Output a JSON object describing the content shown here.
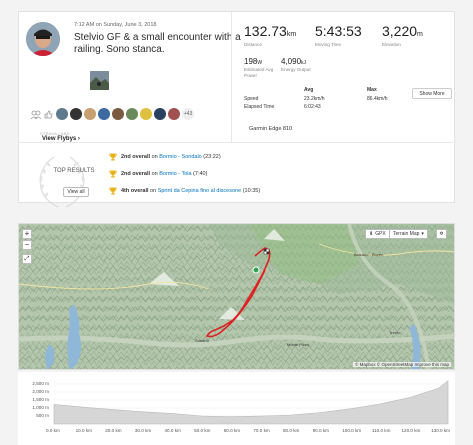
{
  "activity": {
    "date": "7:12 AM on Sunday, June 3, 2018",
    "title": "Stelvio GF & a small encounter with a railing. Sono stanca.",
    "kudos_more": "+43",
    "flyby_label": "STRAVA LABS",
    "flyby_link": "View Flybys ›"
  },
  "stats": {
    "distance": "132.73",
    "distance_unit": "km",
    "distance_label": "Distance",
    "moving_time": "5:43:53",
    "moving_time_label": "Moving Time",
    "elevation": "3,220",
    "elevation_unit": "m",
    "elevation_label": "Elevation",
    "power": "198",
    "power_unit": "W",
    "power_label": "Estimated Avg Power",
    "energy": "4,090",
    "energy_unit": "kJ",
    "energy_label": "Energy Output",
    "col_avg": "Avg",
    "col_max": "Max",
    "row_speed": "Speed",
    "speed_avg": "23.2km/h",
    "speed_max": "86.4km/h",
    "row_elapsed": "Elapsed Time",
    "elapsed": "6:02:43",
    "show_more": "Show More",
    "device": "Garmin Edge 810"
  },
  "top_results": {
    "heading": "TOP RESULTS",
    "view_all": "View all",
    "items": [
      {
        "rank": "2nd overall",
        "on": "on",
        "segment": "Bormio - Sondalo",
        "time": "(23:22)"
      },
      {
        "rank": "2nd overall",
        "on": "on",
        "segment": "Bormio - Tola",
        "time": "(7:40)"
      },
      {
        "rank": "4th overall",
        "on": "on",
        "segment": "Sprint da Cepina fino al discesone",
        "time": "(10:35)"
      }
    ]
  },
  "map": {
    "gpx": "GPX",
    "terrain": "Terrain Map",
    "attribution": "© Mapbox © OpenStreetMap Improve this map",
    "places": [
      "Bolzano - Bozen",
      "Sondrio",
      "Trento",
      "Monte Pizzo"
    ]
  },
  "elevation_profile": {
    "y_ticks": [
      "2,500 m",
      "2,000 m",
      "1,500 m",
      "1,000 m",
      "500 m"
    ],
    "x_ticks": [
      "0.0 km",
      "10.0 km",
      "20.0 km",
      "30.0 km",
      "40.0 km",
      "50.0 km",
      "60.0 km",
      "70.0 km",
      "80.0 km",
      "90.0 km",
      "100.0 km",
      "110.0 km",
      "120.0 km",
      "130.0 km"
    ],
    "x_km": [
      0,
      10,
      20,
      30,
      40,
      50,
      60,
      70,
      80,
      90,
      100,
      110,
      120,
      130,
      133
    ],
    "elev_m": [
      1220,
      1050,
      900,
      760,
      650,
      500,
      450,
      500,
      560,
      720,
      950,
      1250,
      1650,
      2250,
      2700
    ]
  },
  "colors": {
    "strava_orange": "#fc4c02",
    "link_blue": "#0072bc",
    "trophy_gold": "#e8b21a",
    "route_red": "#e02020",
    "elevation_fill": "#d6d6d6"
  }
}
